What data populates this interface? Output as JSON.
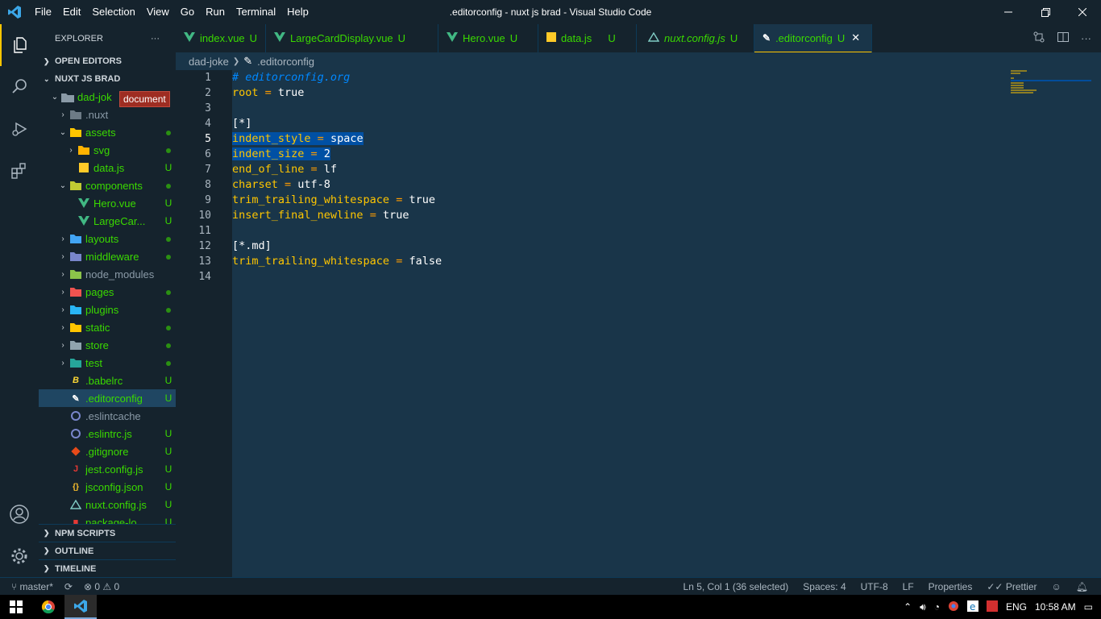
{
  "titlebar": {
    "menu": [
      "File",
      "Edit",
      "Selection",
      "View",
      "Go",
      "Run",
      "Terminal",
      "Help"
    ],
    "title": ".editorconfig - nuxt js brad - Visual Studio Code"
  },
  "sidebar": {
    "header": "EXPLORER",
    "open_editors": "OPEN EDITORS",
    "workspace": "NUXT JS BRAD",
    "root_folder": "dad-jok",
    "tooltip": "document",
    "items": [
      {
        "label": ".nuxt",
        "status": ""
      },
      {
        "label": "assets",
        "status": "dot"
      },
      {
        "label": "svg",
        "status": "dot"
      },
      {
        "label": "data.js",
        "status": "U"
      },
      {
        "label": "components",
        "status": "dot"
      },
      {
        "label": "Hero.vue",
        "status": "U"
      },
      {
        "label": "LargeCar...",
        "status": "U"
      },
      {
        "label": "layouts",
        "status": "dot"
      },
      {
        "label": "middleware",
        "status": "dot"
      },
      {
        "label": "node_modules",
        "status": ""
      },
      {
        "label": "pages",
        "status": "dot"
      },
      {
        "label": "plugins",
        "status": "dot"
      },
      {
        "label": "static",
        "status": "dot"
      },
      {
        "label": "store",
        "status": "dot"
      },
      {
        "label": "test",
        "status": "dot"
      },
      {
        "label": ".babelrc",
        "status": "U"
      },
      {
        "label": ".editorconfig",
        "status": "U"
      },
      {
        "label": ".eslintcache",
        "status": ""
      },
      {
        "label": ".eslintrc.js",
        "status": "U"
      },
      {
        "label": ".gitignore",
        "status": "U"
      },
      {
        "label": "jest.config.js",
        "status": "U"
      },
      {
        "label": "jsconfig.json",
        "status": "U"
      },
      {
        "label": "nuxt.config.js",
        "status": "U"
      },
      {
        "label": "package-lo...",
        "status": "U"
      }
    ],
    "npm_scripts": "NPM SCRIPTS",
    "outline": "OUTLINE",
    "timeline": "TIMELINE"
  },
  "tabs": [
    {
      "label": "index.vue",
      "status": "U"
    },
    {
      "label": "LargeCardDisplay.vue",
      "status": "U"
    },
    {
      "label": "Hero.vue",
      "status": "U"
    },
    {
      "label": "data.js",
      "status": "U"
    },
    {
      "label": "nuxt.config.js",
      "status": "U"
    },
    {
      "label": ".editorconfig",
      "status": "U"
    }
  ],
  "breadcrumb": {
    "folder": "dad-joke",
    "file": ".editorconfig"
  },
  "editor": {
    "line_numbers": [
      "1",
      "2",
      "3",
      "4",
      "5",
      "6",
      "7",
      "8",
      "9",
      "10",
      "11",
      "12",
      "13",
      "14"
    ],
    "lines": [
      "# editorconfig.org",
      "root = true",
      "",
      "[*]",
      "indent_style = space",
      "indent_size = 2",
      "end_of_line = lf",
      "charset = utf-8",
      "trim_trailing_whitespace = true",
      "insert_final_newline = true",
      "",
      "[*.md]",
      "trim_trailing_whitespace = false",
      ""
    ]
  },
  "statusbar": {
    "branch": "master*",
    "problems": "0",
    "warnings": "0",
    "position": "Ln 5, Col 1 (36 selected)",
    "spaces": "Spaces: 4",
    "encoding": "UTF-8",
    "eol": "LF",
    "properties": "Properties",
    "prettier": "Prettier"
  },
  "taskbar": {
    "lang": "ENG",
    "time": "10:58 AM"
  },
  "colors": {
    "accent": "#ffc600",
    "background": "#193549",
    "panel": "#15232d",
    "untracked": "#3ad900"
  }
}
